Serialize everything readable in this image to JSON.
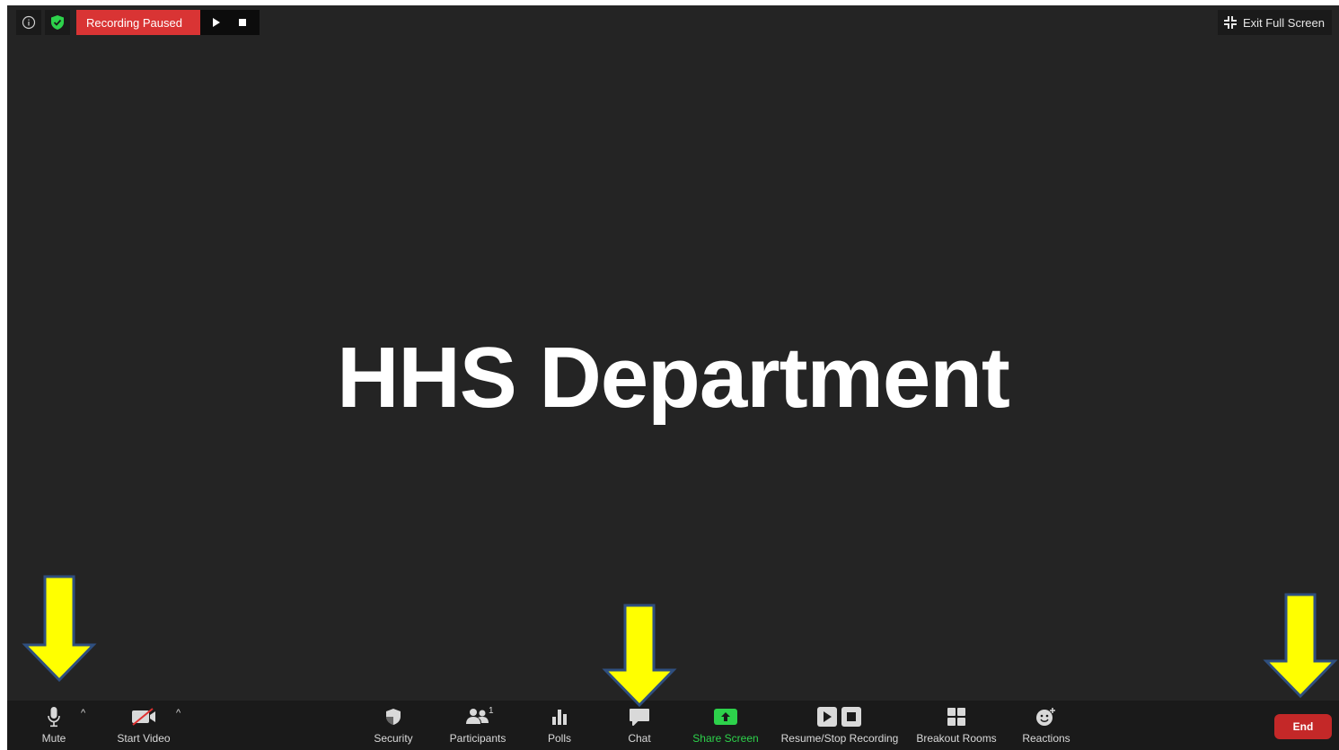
{
  "status_bar": {
    "recording_label": "Recording Paused",
    "exit_fullscreen_label": "Exit Full Screen"
  },
  "meeting": {
    "title": "HHS Department"
  },
  "toolbar": {
    "mute_label": "Mute",
    "video_label": "Start Video",
    "security_label": "Security",
    "participants_label": "Participants",
    "participants_count": "1",
    "polls_label": "Polls",
    "chat_label": "Chat",
    "share_label": "Share Screen",
    "recording_label": "Resume/Stop Recording",
    "breakout_label": "Breakout Rooms",
    "reactions_label": "Reactions",
    "end_label": "End"
  },
  "colors": {
    "background": "#242424",
    "toolbar": "#1a1a1a",
    "recording_red": "#d93434",
    "share_green": "#2dd24b",
    "end_red": "#c42828",
    "annotation_arrow": "#ffff00",
    "annotation_outline": "#2f4f7f"
  },
  "icons": {
    "info": "info-icon",
    "shield": "shield-check-icon",
    "play": "play-icon",
    "stop": "stop-icon",
    "exit_fullscreen": "exit-fullscreen-icon",
    "mic": "microphone-icon",
    "video_off": "video-off-icon",
    "security": "shield-icon",
    "participants": "people-icon",
    "polls": "bar-chart-icon",
    "chat": "speech-bubble-icon",
    "share": "share-screen-icon",
    "recording": "play-stop-icon",
    "breakout": "grid-icon",
    "reactions": "smiley-plus-icon"
  }
}
